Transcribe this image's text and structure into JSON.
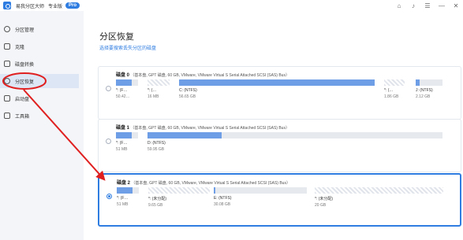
{
  "window": {
    "app_title": "易我分区大师",
    "edition": "专业版",
    "badge": "Pro"
  },
  "window_controls": [
    "⌂",
    "♪",
    "☰",
    "—",
    "✕"
  ],
  "sidebar": {
    "items": [
      {
        "label": "分区管理"
      },
      {
        "label": "克隆"
      },
      {
        "label": "磁盘转换"
      },
      {
        "label": "分区恢复"
      },
      {
        "label": "启动盘"
      },
      {
        "label": "工具箱"
      }
    ]
  },
  "main": {
    "title": "分区恢复",
    "subtitle": "选择要搜索丢失分区的磁盘"
  },
  "disks": [
    {
      "name": "磁盘 0",
      "info": "（基本盘, GPT 磁盘, 60 GB, VMware, VMware Virtual S Serial Attached SCSI (SAS) Bus）",
      "selected": false,
      "partitions": [
        {
          "label": "*: (F…",
          "size": "50.42…",
          "fill": 0.7,
          "hatched": false
        },
        {
          "label": "*: (…",
          "size": "16 MB",
          "fill": 0,
          "hatched": true
        },
        {
          "label": "C: (NTFS)",
          "size": "56.65 GB",
          "fill": 1.0,
          "hatched": false
        },
        {
          "label": "*: (…",
          "size": "1.86 GB",
          "fill": 0,
          "hatched": true
        },
        {
          "label": "J: (NTFS)",
          "size": "2.12 GB",
          "fill": 0.15,
          "hatched": false
        }
      ]
    },
    {
      "name": "磁盘 1",
      "info": "（基本盘, GPT 磁盘, 60 GB, VMware, VMware Virtual S Serial Attached SCSI (SAS) Bus）",
      "selected": false,
      "partitions": [
        {
          "label": "*: (F…",
          "size": "51 MB",
          "fill": 0.7,
          "hatched": false
        },
        {
          "label": "D: (NTFS)",
          "size": "59.95 GB",
          "fill": 0.25,
          "hatched": false
        }
      ]
    },
    {
      "name": "磁盘 2",
      "info": "（基本盘, GPT 磁盘, 60 GB, VMware, VMware Virtual S Serial Attached SCSI (SAS) Bus）",
      "selected": true,
      "partitions": [
        {
          "label": "*: (F…",
          "size": "51 MB",
          "fill": 0.7,
          "hatched": false
        },
        {
          "label": "*: (未分配)",
          "size": "9.65 GB",
          "fill": 0,
          "hatched": true
        },
        {
          "label": "E: (NTFS)",
          "size": "30.08 GB",
          "fill": 0.02,
          "hatched": false
        },
        {
          "label": "*: (未分配)",
          "size": "20 GB",
          "fill": 0,
          "hatched": true
        }
      ]
    }
  ],
  "colors": {
    "accent": "#2f7de1",
    "annotation": "#e02020"
  }
}
